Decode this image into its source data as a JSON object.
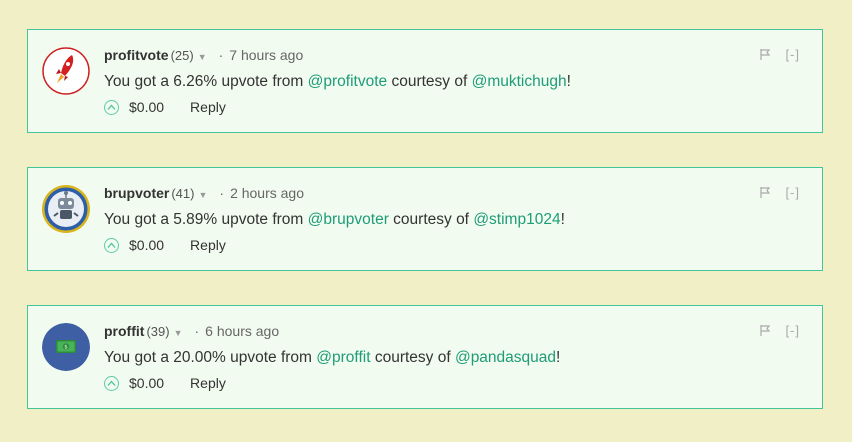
{
  "comments": [
    {
      "author": "profitvote",
      "reputation": "(25)",
      "time": "7 hours ago",
      "text_prefix": "You got a 6.26% upvote from ",
      "mention_1": "@profitvote",
      "text_middle": " courtesy of ",
      "mention_2": "@muktichugh",
      "text_suffix": "!",
      "payout": "$0.00",
      "reply": "Reply",
      "collapse": "[-]",
      "avatar_icon": "red-rocket-icon"
    },
    {
      "author": "brupvoter",
      "reputation": "(41)",
      "time": "2 hours ago",
      "text_prefix": "You got a 5.89% upvote from ",
      "mention_1": "@brupvoter",
      "text_middle": " courtesy of ",
      "mention_2": "@stimp1024",
      "text_suffix": "!",
      "payout": "$0.00",
      "reply": "Reply",
      "collapse": "[-]",
      "avatar_icon": "robot-icon"
    },
    {
      "author": "proffit",
      "reputation": "(39)",
      "time": "6 hours ago",
      "text_prefix": "You got a 20.00% upvote from ",
      "mention_1": "@proffit",
      "text_middle": " courtesy of ",
      "mention_2": "@pandasquad",
      "text_suffix": "!",
      "payout": "$0.00",
      "reply": "Reply",
      "collapse": "[-]",
      "avatar_icon": "money-icon"
    }
  ],
  "colors": {
    "background": "#f1efc6",
    "card_background": "#f2fbef",
    "card_border": "#43c49a",
    "link": "#1e9c7a"
  }
}
